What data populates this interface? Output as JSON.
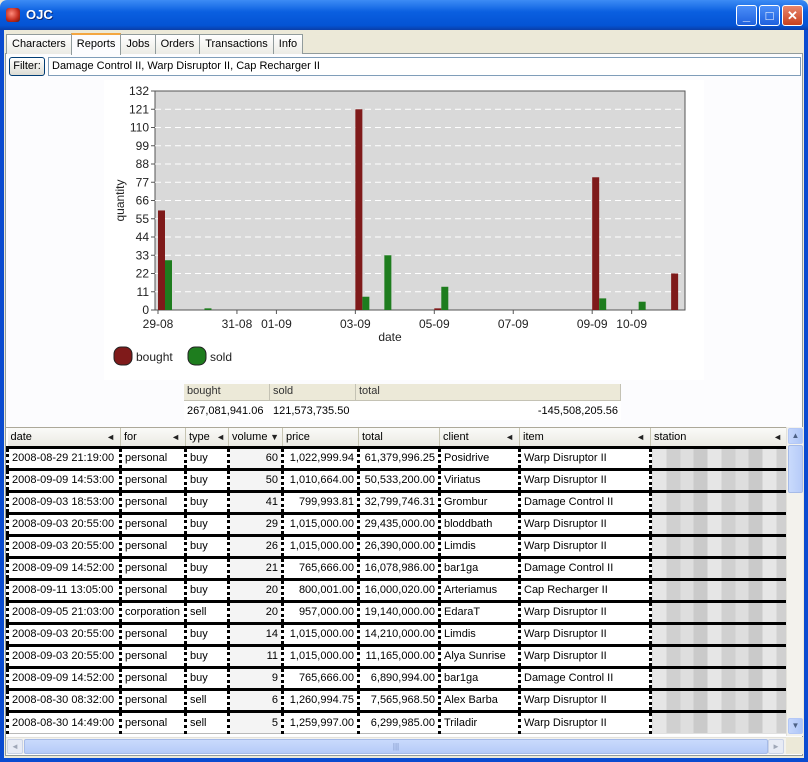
{
  "window": {
    "title": "OJC",
    "minimize": "_",
    "maximize": "□",
    "close": "✕",
    "accent": "#0a5fe0"
  },
  "tabs": [
    "Characters",
    "Reports",
    "Jobs",
    "Orders",
    "Transactions",
    "Info"
  ],
  "active_tab": "Reports",
  "filter": {
    "button": "Filter:",
    "value": "Damage Control II, Warp Disruptor II, Cap Recharger II"
  },
  "chart_data": {
    "type": "bar",
    "ylabel": "quantity",
    "xlabel": "date",
    "ylim": [
      0,
      132
    ],
    "yticks": [
      0,
      11,
      22,
      33,
      44,
      55,
      66,
      77,
      88,
      99,
      110,
      121,
      132
    ],
    "xrange": [
      "2008-08-29",
      "2008-09-11"
    ],
    "xticks": [
      "29-08",
      "31-08",
      "01-09",
      "03-09",
      "05-09",
      "07-09",
      "09-09",
      "10-09"
    ],
    "grid": true,
    "legend_position": "bottom-left",
    "series": [
      {
        "name": "bought",
        "color": "#7f1a1a",
        "points": [
          [
            "2008-08-29",
            60
          ],
          [
            "2008-09-03",
            121
          ],
          [
            "2008-09-05",
            1
          ],
          [
            "2008-09-09",
            80
          ],
          [
            "2008-09-11",
            22
          ]
        ]
      },
      {
        "name": "sold",
        "color": "#1e7d1e",
        "points": [
          [
            "2008-08-29",
            30
          ],
          [
            "2008-08-30",
            1
          ],
          [
            "2008-09-03",
            8
          ],
          [
            "2008-09-03",
            33
          ],
          [
            "2008-09-05",
            14
          ],
          [
            "2008-09-09",
            7
          ],
          [
            "2008-09-10",
            5
          ]
        ]
      }
    ]
  },
  "totals": {
    "headers": [
      "bought",
      "sold",
      "total"
    ],
    "values": [
      "267,081,941.06",
      "121,573,735.50",
      "-145,508,205.56"
    ]
  },
  "table": {
    "columns": [
      "date",
      "for",
      "type",
      "volume",
      "price",
      "total",
      "client",
      "item",
      "station"
    ],
    "rows": [
      [
        "2008-08-29 21:19:00",
        "personal",
        "buy",
        "60",
        "1,022,999.94",
        "61,379,996.25",
        "Posidrive",
        "Warp Disruptor II",
        ""
      ],
      [
        "2008-09-09 14:53:00",
        "personal",
        "buy",
        "50",
        "1,010,664.00",
        "50,533,200.00",
        "Viriatus",
        "Warp Disruptor II",
        ""
      ],
      [
        "2008-09-03 18:53:00",
        "personal",
        "buy",
        "41",
        "799,993.81",
        "32,799,746.31",
        "Grombur",
        "Damage Control II",
        ""
      ],
      [
        "2008-09-03 20:55:00",
        "personal",
        "buy",
        "29",
        "1,015,000.00",
        "29,435,000.00",
        "bloddbath",
        "Warp Disruptor II",
        ""
      ],
      [
        "2008-09-03 20:55:00",
        "personal",
        "buy",
        "26",
        "1,015,000.00",
        "26,390,000.00",
        "Limdis",
        "Warp Disruptor II",
        ""
      ],
      [
        "2008-09-09 14:52:00",
        "personal",
        "buy",
        "21",
        "765,666.00",
        "16,078,986.00",
        "bar1ga",
        "Damage Control II",
        ""
      ],
      [
        "2008-09-11 13:05:00",
        "personal",
        "buy",
        "20",
        "800,001.00",
        "16,000,020.00",
        "Arteriamus",
        "Cap Recharger II",
        ""
      ],
      [
        "2008-09-05 21:03:00",
        "corporation",
        "sell",
        "20",
        "957,000.00",
        "19,140,000.00",
        "EdaraT",
        "Warp Disruptor II",
        ""
      ],
      [
        "2008-09-03 20:55:00",
        "personal",
        "buy",
        "14",
        "1,015,000.00",
        "14,210,000.00",
        "Limdis",
        "Warp Disruptor II",
        ""
      ],
      [
        "2008-09-03 20:55:00",
        "personal",
        "buy",
        "11",
        "1,015,000.00",
        "11,165,000.00",
        "Alya Sunrise",
        "Warp Disruptor II",
        ""
      ],
      [
        "2008-09-09 14:52:00",
        "personal",
        "buy",
        "9",
        "765,666.00",
        "6,890,994.00",
        "bar1ga",
        "Damage Control II",
        ""
      ],
      [
        "2008-08-30 08:32:00",
        "personal",
        "sell",
        "6",
        "1,260,994.75",
        "7,565,968.50",
        "Alex Barba",
        "Warp Disruptor II",
        ""
      ],
      [
        "2008-08-30 14:49:00",
        "personal",
        "sell",
        "5",
        "1,259,997.00",
        "6,299,985.00",
        "Triladir",
        "Warp Disruptor II",
        ""
      ]
    ]
  }
}
